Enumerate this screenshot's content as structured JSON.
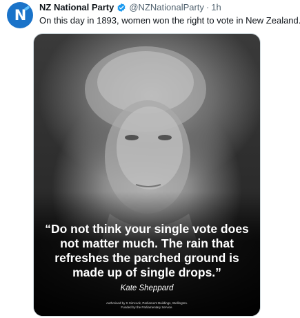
{
  "tweet": {
    "author_name": "NZ National Party",
    "handle": "@NZNationalParty",
    "separator": "·",
    "time": "1h",
    "text": "On this day in 1893, women won the right to vote in New Zealand."
  },
  "avatar": {
    "letter": "N",
    "bg_color": "#1a73c9"
  },
  "verified": {
    "icon": "verified-badge-icon",
    "color": "#1d9bf0"
  },
  "media": {
    "quote": "“Do not think your single vote does not matter much. The rain that refreshes the parched ground is made up of single drops.”",
    "quote_author": "Kate Sheppard",
    "authorised_line1": "Authorised by S Simcock, Parliament Buildings, Wellington.",
    "authorised_line2": "Funded by the Parliamentary Service."
  }
}
